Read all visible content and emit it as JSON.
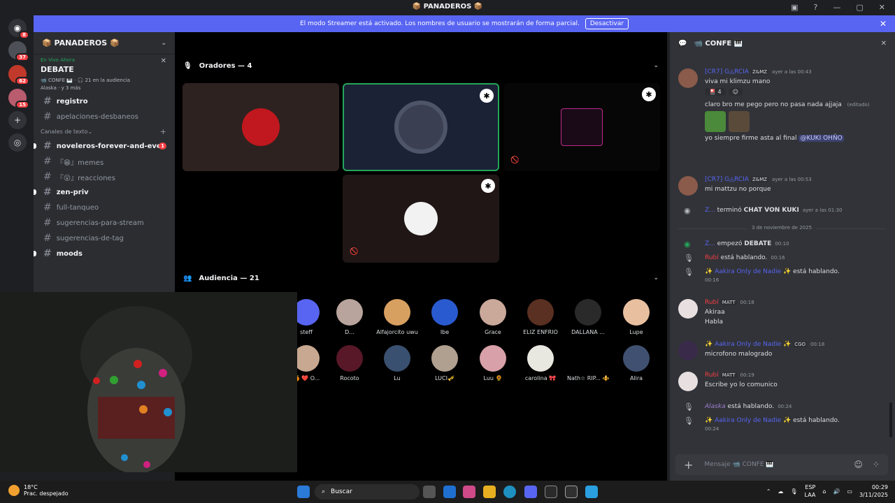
{
  "window": {
    "title": "📦 PANADEROS 📦"
  },
  "banner": {
    "text": "El modo Streamer está activado. Los nombres de usuario se mostrarán de forma parcial.",
    "button": "Desactivar"
  },
  "guild_badges": [
    "8",
    "37",
    "62",
    "15"
  ],
  "server": {
    "name": "📦 PANADEROS 📦",
    "live_label": "En Vivo Ahora",
    "live_name": "DEBATE",
    "live_meta1": "📹 CONFE 🎹  ·  🎧 21 en la audiencia",
    "live_meta2": "Alaska  ·  y 3 más",
    "channels_top": [
      {
        "name": "registro",
        "bold": true
      },
      {
        "name": "apelaciones-desbaneos",
        "bold": false
      }
    ],
    "category": "Canales de texto",
    "channels": [
      {
        "name": "noveleros-forever-and-ever",
        "bold": true,
        "badge": "1"
      },
      {
        "name": "『😁』memes",
        "bold": false
      },
      {
        "name": "『😮』reacciones",
        "bold": false
      },
      {
        "name": "zen-priv",
        "bold": true
      },
      {
        "name": "full-tanqueo",
        "bold": false
      },
      {
        "name": "sugerencias-para-stream",
        "bold": false
      },
      {
        "name": "sugerencias-de-tag",
        "bold": false
      },
      {
        "name": "moods",
        "bold": true
      }
    ]
  },
  "stage": {
    "speakers_header": "Oradores — 4",
    "audience_header": "Audiencia — 21",
    "audience_row1": [
      "steff",
      "D...",
      "Alfajorcito uwu",
      "Ibe",
      "Grace",
      "ELIZ ENFRIO",
      "DALLANA ...",
      "Lupe"
    ],
    "audience_row2": [
      "🍊 ❤️ O...",
      "Rocoto",
      "Lu",
      "LUCI🎺",
      "Luu 🌻",
      "carolina 🎀",
      "Nath☆ RIP... ⚜️",
      "Alira"
    ]
  },
  "chat": {
    "title": "📹 CONFE 🎹",
    "messages": [
      {
        "user": "[CR7] G◬RCIA",
        "tag": "Z&MZ",
        "time": "ayer a las 00:43",
        "lines": [
          "viva mi klimzu mano"
        ],
        "reaction": "4"
      },
      {
        "line": "claro bro me pego pero no pasa nada ajjaja",
        "edited": "(editado)"
      },
      {
        "line": "yo siempre firme asta al final",
        "mention": "@KUKI OHÑO"
      },
      {
        "user": "[CR7] G◬RCIA",
        "tag": "Z&MZ",
        "time": "ayer a las 00:53",
        "lines": [
          "mi mattzu no  porque"
        ]
      },
      {
        "sys_user": "Z...",
        "sys_text": "terminó",
        "sys_bold": "CHAT VON KUKI",
        "time": "ayer a las 01:30"
      }
    ],
    "date_divider": "3 de noviembre de 2025",
    "events": [
      {
        "user": "Z...",
        "text": "empezó",
        "bold": "DEBATE",
        "time": "00:10"
      },
      {
        "user": "Rubí",
        "text": "está hablando.",
        "time": "00:16"
      },
      {
        "user": "✨ Aakira Only de Nadie ✨",
        "text": "está hablando.",
        "time": "00:16"
      }
    ],
    "msgs2": [
      {
        "user": "Rubí",
        "tag": "MATT",
        "time": "00:18",
        "lines": [
          "Akiraa",
          "Habla"
        ]
      },
      {
        "user": "✨ Aakira Only de Nadie ✨",
        "tag": "CGO",
        "time": "00:18",
        "lines": [
          "microfono malogrado"
        ]
      },
      {
        "user": "Rubí",
        "tag": "MATT",
        "time": "00:19",
        "lines": [
          "Escribe yo lo comunico"
        ]
      }
    ],
    "events2": [
      {
        "user": "Alaska",
        "text": "está hablando.",
        "time": "00:24"
      },
      {
        "user": "✨ Aakira Only de Nadie ✨",
        "text": "está hablando.",
        "time": "00:24"
      }
    ],
    "composer_placeholder": "Mensaje 📹 CONFE 🎹"
  },
  "taskbar": {
    "temp": "18°C",
    "weather": "Prac. despejado",
    "search": "Buscar",
    "lang1": "ESP",
    "lang2": "LAA",
    "time": "00:29",
    "date": "3/11/2025"
  }
}
